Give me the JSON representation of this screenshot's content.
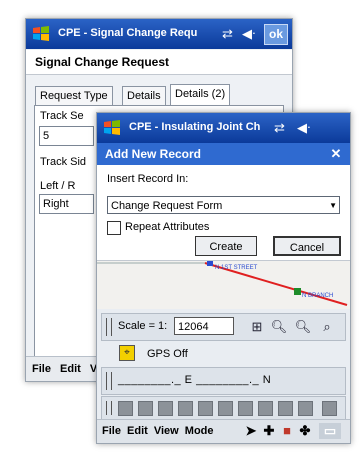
{
  "back_window": {
    "title": "CPE - Signal Change Requ",
    "ok_label": "ok",
    "form_header": "Signal Change Request",
    "tabs": [
      "Request Type",
      "Details",
      "Details (2)"
    ],
    "fields": {
      "track_label": "Track Se",
      "track_value": "5",
      "track_side_label": "Track Sid",
      "left_right_label": "Left / R",
      "left_right_value": "Right"
    },
    "menu": [
      "File",
      "Edit",
      "V"
    ]
  },
  "front_window": {
    "title": "CPE - Insulating Joint Ch",
    "dialog_title": "Add New Record",
    "insert_label": "Insert Record In:",
    "insert_value": "Change Request Form",
    "repeat_label": "Repeat Attributes",
    "create_label": "Create",
    "cancel_label": "Cancel",
    "map_labels": {
      "street": "N 1ST STREET",
      "branch": "N BRANCH"
    },
    "scale_label": "Scale = 1:",
    "scale_value": "12064",
    "gps_status": "GPS Off",
    "coords_text": "________._ E ________._ N",
    "menu": [
      "File",
      "Edit",
      "View",
      "Mode"
    ]
  },
  "colors": {
    "titlebar": "#0b3a9a",
    "dialog_header": "#2f6ad0",
    "map_line": "#e02020",
    "map_point_green": "#1e8c2a",
    "map_point_blue": "#2b4bd0"
  },
  "icons": [
    "windows-logo-icon",
    "signal-arrows-icon",
    "volume-icon",
    "close-icon",
    "pan-icon",
    "zoom-in-icon",
    "zoom-out-icon",
    "zoom-extent-icon",
    "gps-icon",
    "pointer-icon",
    "crosshair-icon",
    "layer-icon",
    "keyboard-icon"
  ]
}
